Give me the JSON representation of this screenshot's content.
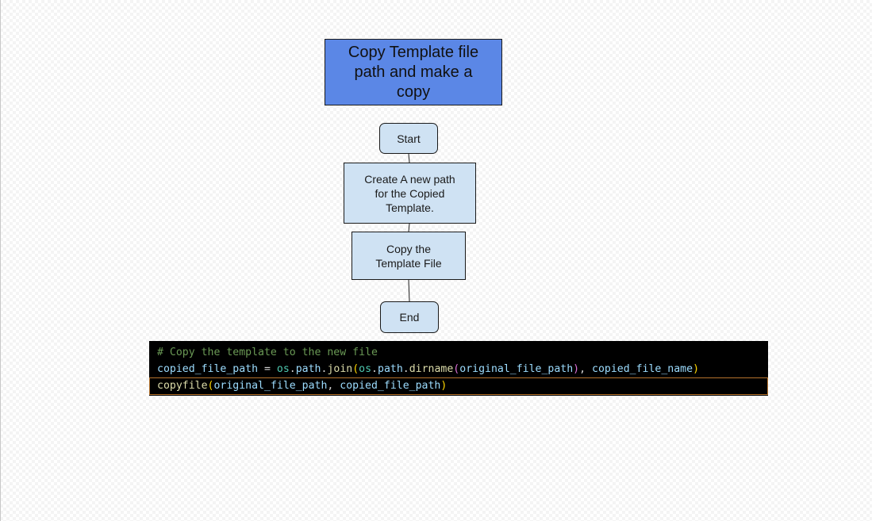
{
  "diagram": {
    "title_lines": [
      "Copy Template file",
      "path and make a",
      "copy"
    ],
    "nodes": {
      "start": {
        "label": "Start"
      },
      "create": {
        "lines": [
          "Create A new path",
          "for the Copied",
          "Template."
        ]
      },
      "copy": {
        "lines": [
          "Copy the",
          "Template File"
        ]
      },
      "end": {
        "label": "End"
      }
    },
    "colors": {
      "title_fill": "#5b87e6",
      "node_fill": "#cfe2f3",
      "border": "#1a1a1a"
    }
  },
  "code": {
    "lines": [
      {
        "tokens": [
          {
            "text": "# Copy the template to the new file",
            "kind": "comment"
          }
        ]
      },
      {
        "tokens": [
          {
            "text": "copied_file_path",
            "kind": "var"
          },
          {
            "text": " = ",
            "kind": "op"
          },
          {
            "text": "os",
            "kind": "mod"
          },
          {
            "text": ".",
            "kind": "op"
          },
          {
            "text": "path",
            "kind": "var"
          },
          {
            "text": ".",
            "kind": "op"
          },
          {
            "text": "join",
            "kind": "func"
          },
          {
            "text": "(",
            "kind": "p1"
          },
          {
            "text": "os",
            "kind": "mod"
          },
          {
            "text": ".",
            "kind": "op"
          },
          {
            "text": "path",
            "kind": "var"
          },
          {
            "text": ".",
            "kind": "op"
          },
          {
            "text": "dirname",
            "kind": "func"
          },
          {
            "text": "(",
            "kind": "p2"
          },
          {
            "text": "original_file_path",
            "kind": "var"
          },
          {
            "text": ")",
            "kind": "p2"
          },
          {
            "text": ", ",
            "kind": "op"
          },
          {
            "text": "copied_file_name",
            "kind": "var"
          },
          {
            "text": ")",
            "kind": "p1"
          }
        ]
      },
      {
        "tokens": [
          {
            "text": "copyfile",
            "kind": "func"
          },
          {
            "text": "(",
            "kind": "p1"
          },
          {
            "text": "original_file_path",
            "kind": "var"
          },
          {
            "text": ", ",
            "kind": "op"
          },
          {
            "text": "copied_file_path",
            "kind": "var"
          },
          {
            "text": ")",
            "kind": "p1"
          }
        ]
      }
    ],
    "colors": {
      "background": "#000000",
      "comment": "#6a9955",
      "variable": "#9cdcfe",
      "module": "#4ec9b0",
      "function": "#dcdcaa",
      "bracket_1": "#ffd700",
      "bracket_2": "#da70d6",
      "active_line_border": "#b4722c"
    }
  }
}
